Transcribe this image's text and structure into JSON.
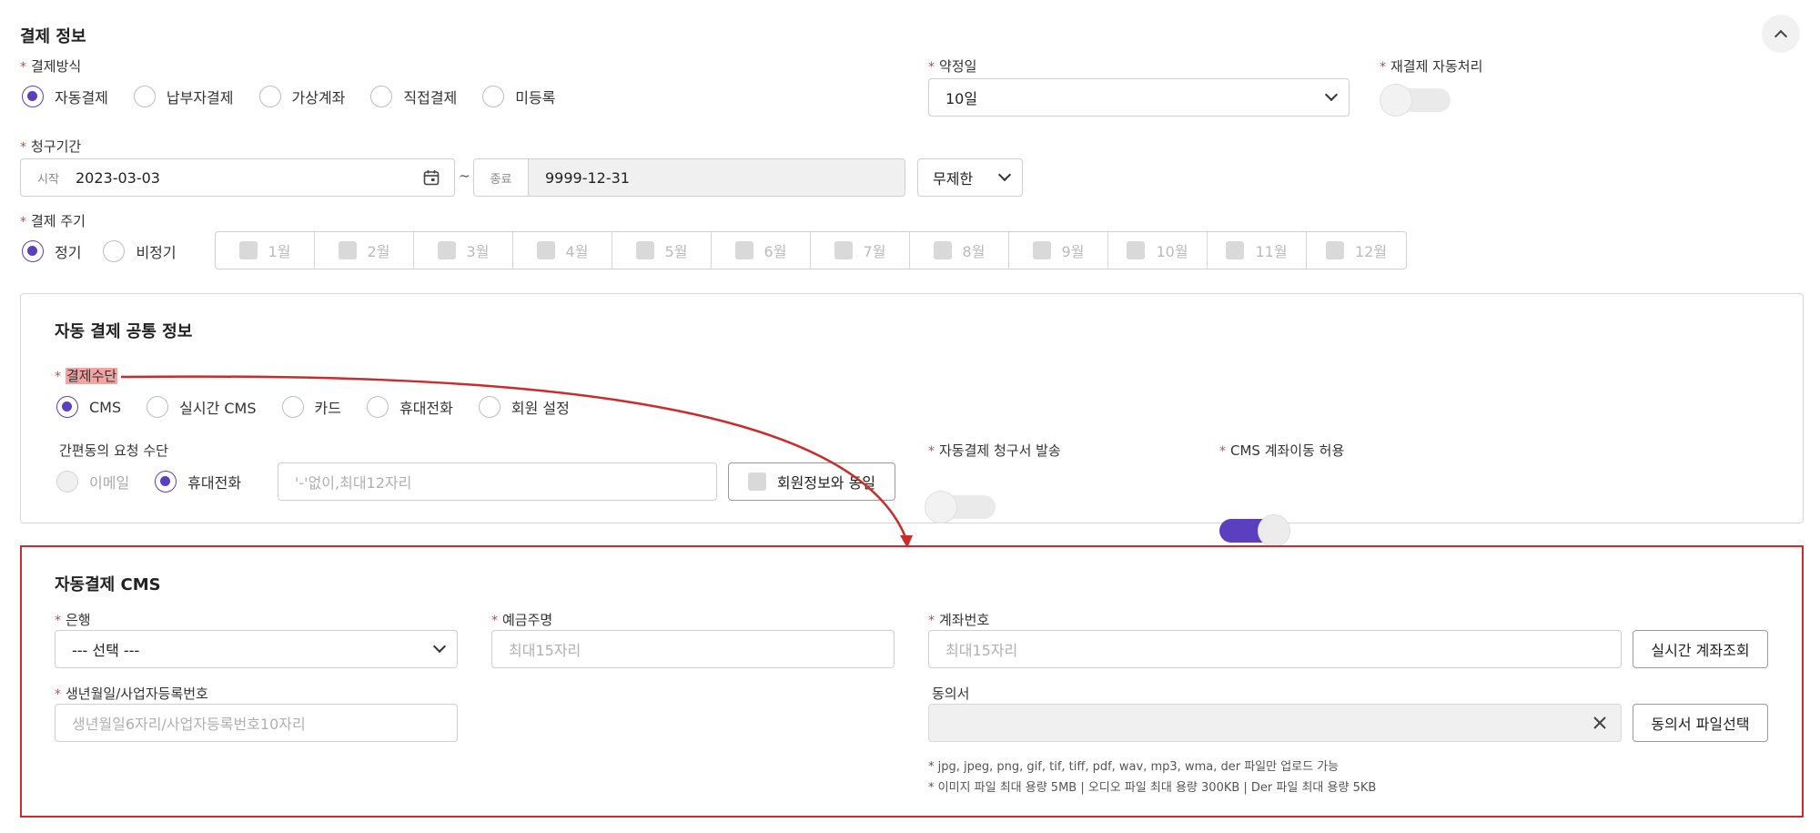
{
  "payment_info": {
    "title": "결제 정보",
    "method_label": "결제방식",
    "methods": [
      "자동결제",
      "납부자결제",
      "가상계좌",
      "직접결제",
      "미등록"
    ],
    "agreed_day_label": "약정일",
    "agreed_day_value": "10일",
    "retry_label": "재결제 자동처리",
    "billing_period_label": "청구기간",
    "start_tag": "시작",
    "start_value": "2023-03-03",
    "tilde": "~",
    "end_tag": "종료",
    "end_value": "9999-12-31",
    "unlimited_value": "무제한",
    "cycle_label": "결제 주기",
    "cycle_options": [
      "정기",
      "비정기"
    ],
    "months": [
      "1월",
      "2월",
      "3월",
      "4월",
      "5월",
      "6월",
      "7월",
      "8월",
      "9월",
      "10월",
      "11월",
      "12월"
    ]
  },
  "auto_common": {
    "title": "자동 결제 공통 정보",
    "means_label": "결제수단",
    "means": [
      "CMS",
      "실시간 CMS",
      "카드",
      "휴대전화",
      "회원 설정"
    ],
    "simple_consent_label": "간편동의 요청 수단",
    "simple_options": [
      "이메일",
      "휴대전화"
    ],
    "phone_placeholder": "'-'없이,최대12자리",
    "same_member_label": "회원정보와 동일",
    "invoice_label": "자동결제 청구서 발송",
    "cms_transfer_label": "CMS 계좌이동 허용"
  },
  "auto_cms": {
    "title": "자동결제 CMS",
    "bank_label": "은행",
    "bank_value": "--- 선택 ---",
    "holder_label": "예금주명",
    "holder_placeholder": "최대15자리",
    "account_label": "계좌번호",
    "account_placeholder": "최대15자리",
    "realtime_button": "실시간 계좌조회",
    "birth_label": "생년월일/사업자등록번호",
    "birth_placeholder": "생년월일6자리/사업자등록번호10자리",
    "consent_label": "동의서",
    "consent_button": "동의서 파일선택",
    "hint1": "* jpg, jpeg, png, gif, tif, tiff, pdf, wav, mp3, wma, der 파일만 업로드 가능",
    "hint2": "* 이미지 파일 최대 용량 5MB | 오디오 파일 최대 용량 300KB | Der 파일 최대 용량 5KB"
  },
  "colors": {
    "accent": "#5a3fbf",
    "required": "#e0443b",
    "annotation": "#cc2b2b",
    "highlight": "#f4a3a3"
  },
  "icons": [
    "chevron-up-icon",
    "chevron-down-icon",
    "calendar-icon",
    "close-icon",
    "annotation-arrow"
  ]
}
